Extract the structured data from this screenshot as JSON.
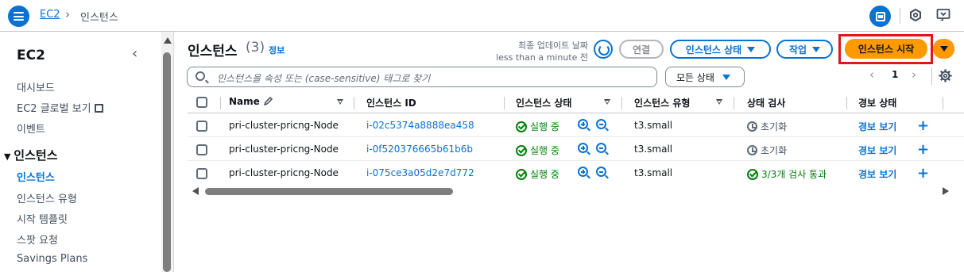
{
  "breadcrumb": {
    "root": "EC2",
    "current": "인스턴스"
  },
  "sidebar": {
    "title": "EC2",
    "items": [
      {
        "label": "대시보드"
      },
      {
        "label": "EC2 글로벌 보기"
      },
      {
        "label": "이벤트"
      }
    ],
    "section": "인스턴스",
    "section_items": [
      {
        "label": "인스턴스",
        "active": true
      },
      {
        "label": "인스턴스 유형"
      },
      {
        "label": "시작 템플릿"
      },
      {
        "label": "스팟 요청"
      },
      {
        "label": "Savings Plans"
      }
    ]
  },
  "header": {
    "title": "인스턴스",
    "count": "(3)",
    "info": "정보",
    "last_updated_label": "최종 업데이트 날짜",
    "last_updated_value": "less than a minute 전",
    "connect": "연결",
    "instance_state": "인스턴스 상태",
    "actions": "작업",
    "launch": "인스턴스 시작"
  },
  "filter": {
    "search_placeholder": "인스턴스을 속성 또는 (case-sensitive) 태그로 찾기",
    "state_filter": "모든 상태",
    "page": "1"
  },
  "table": {
    "columns": [
      "Name",
      "인스턴스 ID",
      "인스턴스 상태",
      "인스턴스 유형",
      "상태 검사",
      "경보 상태"
    ],
    "rows": [
      {
        "name": "pri-cluster-pricng-Node",
        "id": "i-02c5374a8888ea458",
        "state": "실행 중",
        "type": "t3.small",
        "check": "초기화",
        "check_ok": false,
        "alarm": "경보 보기"
      },
      {
        "name": "pri-cluster-pricng-Node",
        "id": "i-0f520376665b61b6b",
        "state": "실행 중",
        "type": "t3.small",
        "check": "초기화",
        "check_ok": false,
        "alarm": "경보 보기"
      },
      {
        "name": "pri-cluster-pricng-Node",
        "id": "i-075ce3a05d2e7d772",
        "state": "실행 중",
        "type": "t3.small",
        "check": "3/3개 검사 통과",
        "check_ok": true,
        "alarm": "경보 보기"
      }
    ]
  },
  "colors": {
    "accent": "#0972d3",
    "primary": "#ff9900",
    "success": "#037f0c",
    "highlight": "#e0161c"
  }
}
